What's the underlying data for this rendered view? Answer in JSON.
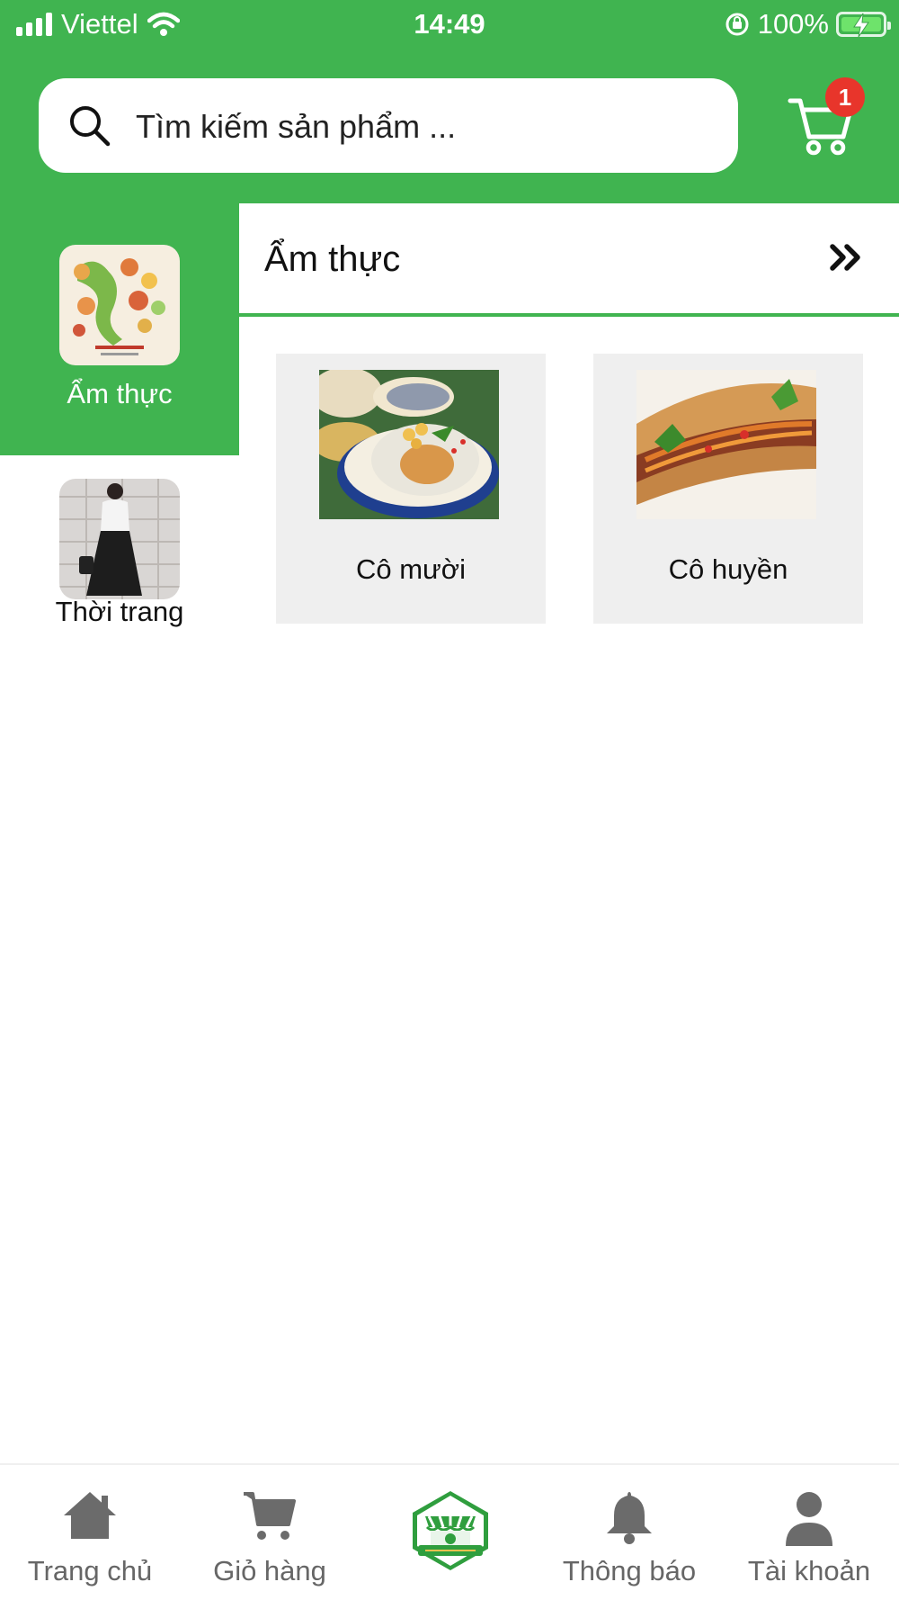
{
  "status_bar": {
    "carrier": "Viettel",
    "time": "14:49",
    "battery": "100%",
    "icons": [
      "signal-bars-icon",
      "wifi-icon",
      "orientation-lock-icon",
      "battery-charging-icon"
    ]
  },
  "search": {
    "placeholder": "Tìm kiếm sản phẩm ..."
  },
  "cart": {
    "badge_count": "1",
    "badge_color": "#e8352b"
  },
  "sidebar": {
    "items": [
      {
        "label": "Ẩm thực",
        "active": true
      },
      {
        "label": "Thời trang",
        "active": false
      }
    ]
  },
  "section": {
    "title": "Ẩm thực",
    "more_icon": "double-chevron-right-icon"
  },
  "products": [
    {
      "name": "Cô mười"
    },
    {
      "name": "Cô huyền"
    }
  ],
  "bottom_nav": {
    "items": [
      {
        "label": "Trang chủ",
        "icon": "home-icon"
      },
      {
        "label": "Giỏ hàng",
        "icon": "cart-icon"
      },
      {
        "label": "",
        "icon": "market-logo-icon"
      },
      {
        "label": "Thông báo",
        "icon": "bell-icon"
      },
      {
        "label": "Tài khoản",
        "icon": "user-icon"
      }
    ]
  },
  "colors": {
    "brand_green": "#40b450",
    "card_background": "#efefef",
    "nav_icon_gray": "#6b6b6b"
  }
}
